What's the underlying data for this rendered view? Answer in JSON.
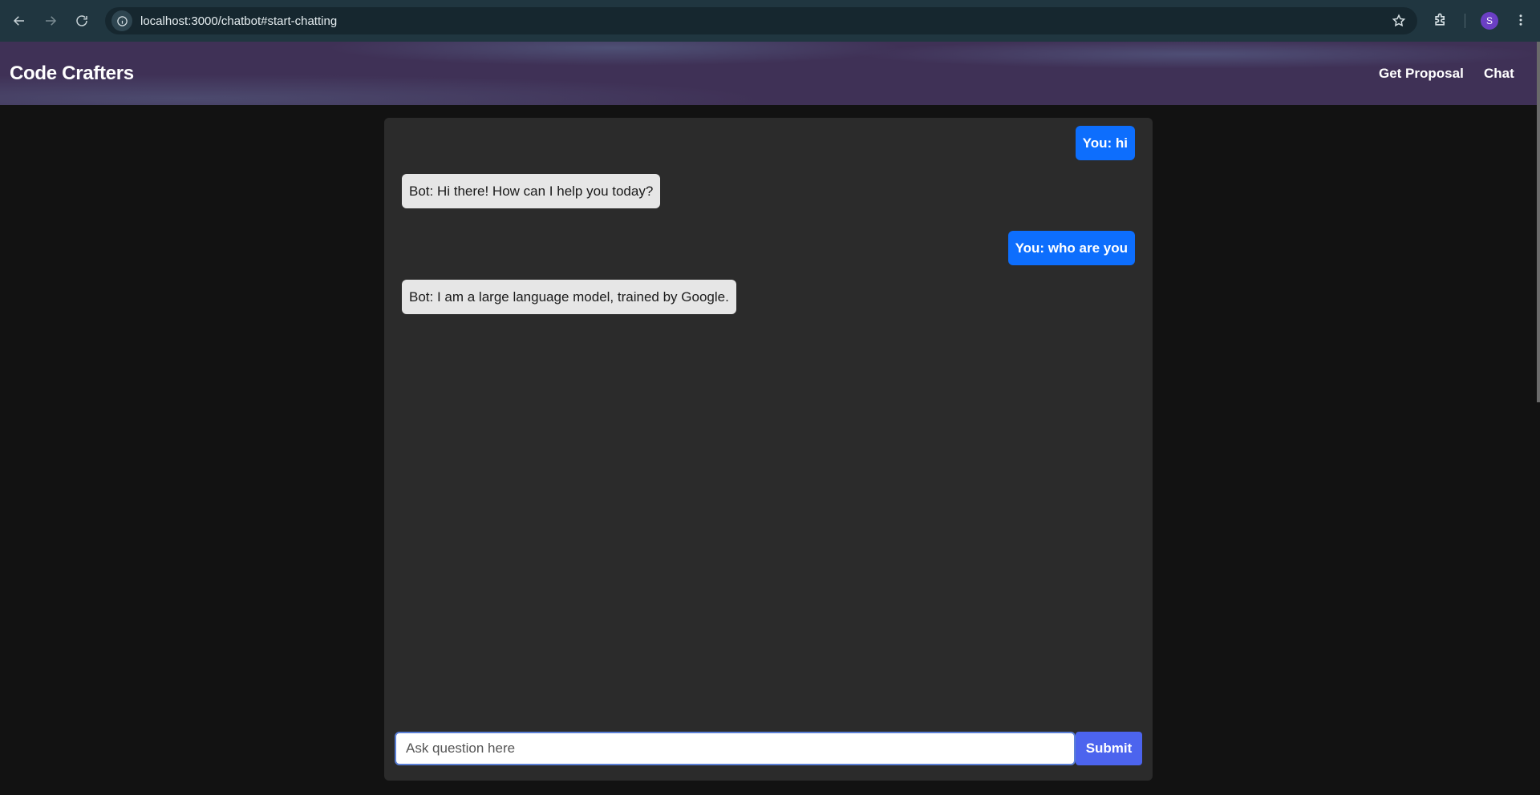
{
  "browser": {
    "url": "localhost:3000/chatbot#start-chatting",
    "profile_initial": "S"
  },
  "header": {
    "brand": "Code Crafters",
    "nav": [
      "Get Proposal",
      "Chat"
    ]
  },
  "chat": {
    "messages": [
      {
        "sender": "user",
        "text": "You: hi"
      },
      {
        "sender": "bot",
        "text": "Bot: Hi there! How can I help you today?"
      },
      {
        "sender": "user",
        "text": "You: who are you"
      },
      {
        "sender": "bot",
        "text": "Bot: I am a large language model, trained by Google."
      }
    ],
    "input_placeholder": "Ask question here",
    "input_value": "",
    "submit_label": "Submit"
  },
  "colors": {
    "user_bubble": "#0d6efd",
    "bot_bubble": "#e6e6e6",
    "submit_button": "#4c64ee",
    "panel": "#2b2b2b"
  }
}
